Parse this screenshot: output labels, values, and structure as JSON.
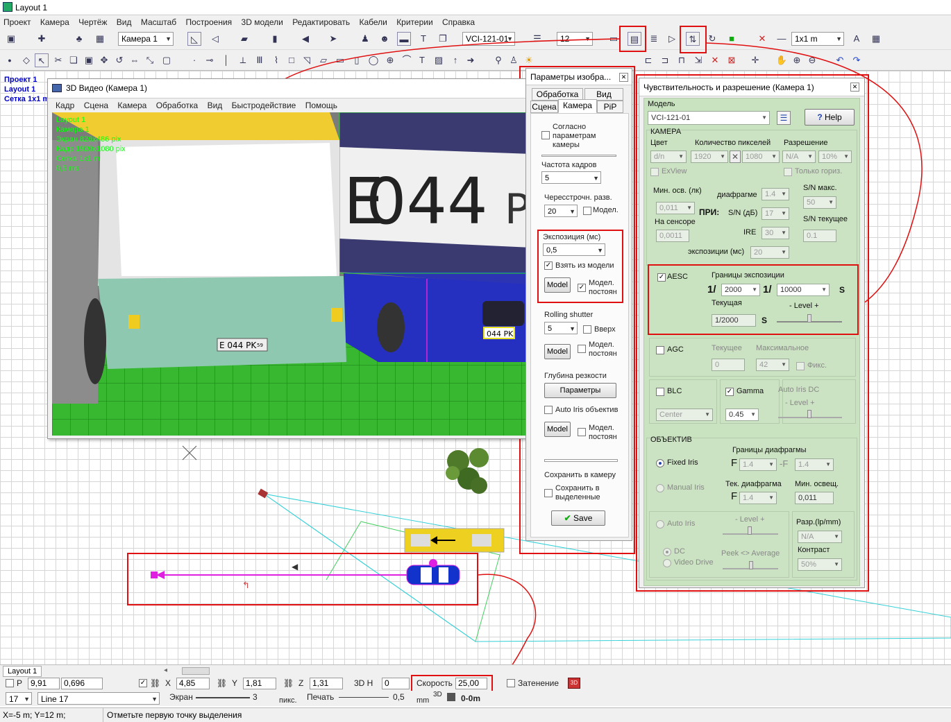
{
  "app": {
    "title": "Layout 1"
  },
  "menu": [
    "Проект",
    "Камера",
    "Чертёж",
    "Вид",
    "Масштаб",
    "Построения",
    "3D модели",
    "Редактировать",
    "Кабели",
    "Критерии",
    "Справка"
  ],
  "toolbar": {
    "camera_select": "Камера 1",
    "model_select": "VCI-121-01",
    "size_value": "12",
    "scale_select": "1x1 m"
  },
  "tree": [
    "Проект 1",
    "Layout 1",
    "Сетка 1x1 m"
  ],
  "video3d": {
    "title": "3D Видео (Камера 1)",
    "menu": [
      "Кадр",
      "Сцена",
      "Камера",
      "Обработка",
      "Вид",
      "Быстродействие",
      "Помощь"
    ],
    "overlay": [
      "Layout 1",
      "Камера 1",
      "Экран 826x486 pix",
      "Кадр 1920x1080 pix",
      "Сетка 1x1 m",
      "0,5 ms"
    ],
    "plate_big": "044",
    "plate_big_suffix": "P",
    "plate_big_prefix": "E",
    "plate_bus": "E 044 PK",
    "plate_bus_region": "59",
    "plate_car": "044 PK"
  },
  "params": {
    "title": "Параметры изобра...",
    "tabs_top": [
      "Обработка",
      "Вид"
    ],
    "tabs_bottom": [
      "Сцена",
      "Камера",
      "PiP"
    ],
    "agree_label": "Согласно параметрам камеры",
    "fps_label": "Частота кадров",
    "fps_value": "5",
    "interlace_label": "Чересстрочн. разв.",
    "interlace_value": "20",
    "model_label": "Модел.",
    "exposure_label": "Экспозиция (мс)",
    "exposure_value": "0,5",
    "take_from_model": "Взять из модели",
    "model_btn": "Model",
    "model_const": "Модел. постоян",
    "rolling_label": "Rolling shutter",
    "rolling_value": "5",
    "up_label": "Вверх",
    "dof_label": "Глубина резкости",
    "params_btn": "Параметры",
    "auto_iris": "Auto Iris объектив",
    "save_to_camera": "Сохранить в камеру",
    "save_selected": "Сохранить в выделенные",
    "save_btn": "Save"
  },
  "sens": {
    "title": "Чувствительность и разрешение (Камера 1)",
    "model_label": "Модель",
    "model_value": "VCI-121-01",
    "help_btn": "Help",
    "camera_section": "КАМЕРА",
    "color_label": "Цвет",
    "pixels_label": "Количество пикселей",
    "resolution_label": "Разрешение",
    "color_value": "d/n",
    "px_w": "1920",
    "px_h": "1080",
    "res_value": "N/A",
    "res_pct": "10%",
    "exview": "ExView",
    "only_horiz": "Только гориз.",
    "min_illum_label": "Мин. осв. (лк)",
    "aperture_label": "диафрагме",
    "aperture_value": "1.4",
    "sn_max_label": "S/N макс.",
    "min_illum_value": "0,011",
    "at_label": "ПРИ:",
    "sn_db_label": "S/N (дБ)",
    "sn_db_value": "17",
    "sn_max_value": "50",
    "on_sensor_label": "На сенсоре",
    "sn_current_label": "S/N текущее",
    "ire_label": "IRE",
    "ire_value": "30",
    "sensor_value": "0,0011",
    "sn_current_value": "0.1",
    "exp_label": "экспозиции (мс)",
    "exp_value": "20",
    "aesc": "AESC",
    "exp_limits": "Границы экспозиции",
    "one_over": "1/",
    "exp_min": "2000",
    "exp_max": "10000",
    "s_unit": "S",
    "current_label": "Текущая",
    "level_label": "- Level +",
    "current_value": "1/2000",
    "agc": "AGC",
    "agc_current_label": "Текущее",
    "agc_max_label": "Максимальное",
    "agc_current": "0",
    "agc_max": "42",
    "fix_label": "Фикс.",
    "blc": "BLC",
    "gamma": "Gamma",
    "auto_iris_dc": "Auto Iris DC",
    "blc_value": "Center",
    "gamma_value": "0.45",
    "lens_section": "ОБЪЕКТИВ",
    "ap_limits": "Границы диафрагмы",
    "fixed_iris": "Fixed Iris",
    "f_letter": "F",
    "ap_min": "1.4",
    "dash_f": "-F",
    "ap_max": "1.4",
    "manual_iris": "Manual Iris",
    "cur_ap_label": "Тек. диафрагма",
    "min_light_label": "Мин. освещ.",
    "cur_ap": "1.4",
    "min_light": "0,011",
    "auto_iris": "Auto Iris",
    "resolution_lp": "Разр.(lp/mm)",
    "res_lp_value": "N/A",
    "dc": "DC",
    "video_drive": "Video Drive",
    "peek_avg": "Peek  <>  Average",
    "contrast_label": "Контраст",
    "contrast_value": "50%"
  },
  "bottom": {
    "tab": "Layout 1",
    "p_label": "P",
    "p1": "9,91",
    "p2": "0,696",
    "x_label": "X",
    "x_value": "4,85",
    "y_label": "Y",
    "y_value": "1,81",
    "z_label": "Z",
    "z_value": "1,31",
    "h3d_label": "3D H",
    "h3d_value": "0",
    "speed_label": "Скорость",
    "speed_value": "25,00",
    "shade_label": "Затенение",
    "line_num": "17",
    "line_name": "Line 17",
    "screen_label": "Экран",
    "screen_value": "3",
    "px_label": "пикс.",
    "print_label": "Печать",
    "print_value": "0,5",
    "mm_label": "mm",
    "d3_label": "3D",
    "dist_value": "0-0m"
  },
  "status": {
    "coords": "X=-5 m; Y=12 m;",
    "hint": "Отметьте первую точку выделения"
  },
  "colors": {
    "highlight": "#e01010",
    "panel_green": "#c9e2c0",
    "grid_green": "#22aa22",
    "magenta": "#e020e0"
  }
}
